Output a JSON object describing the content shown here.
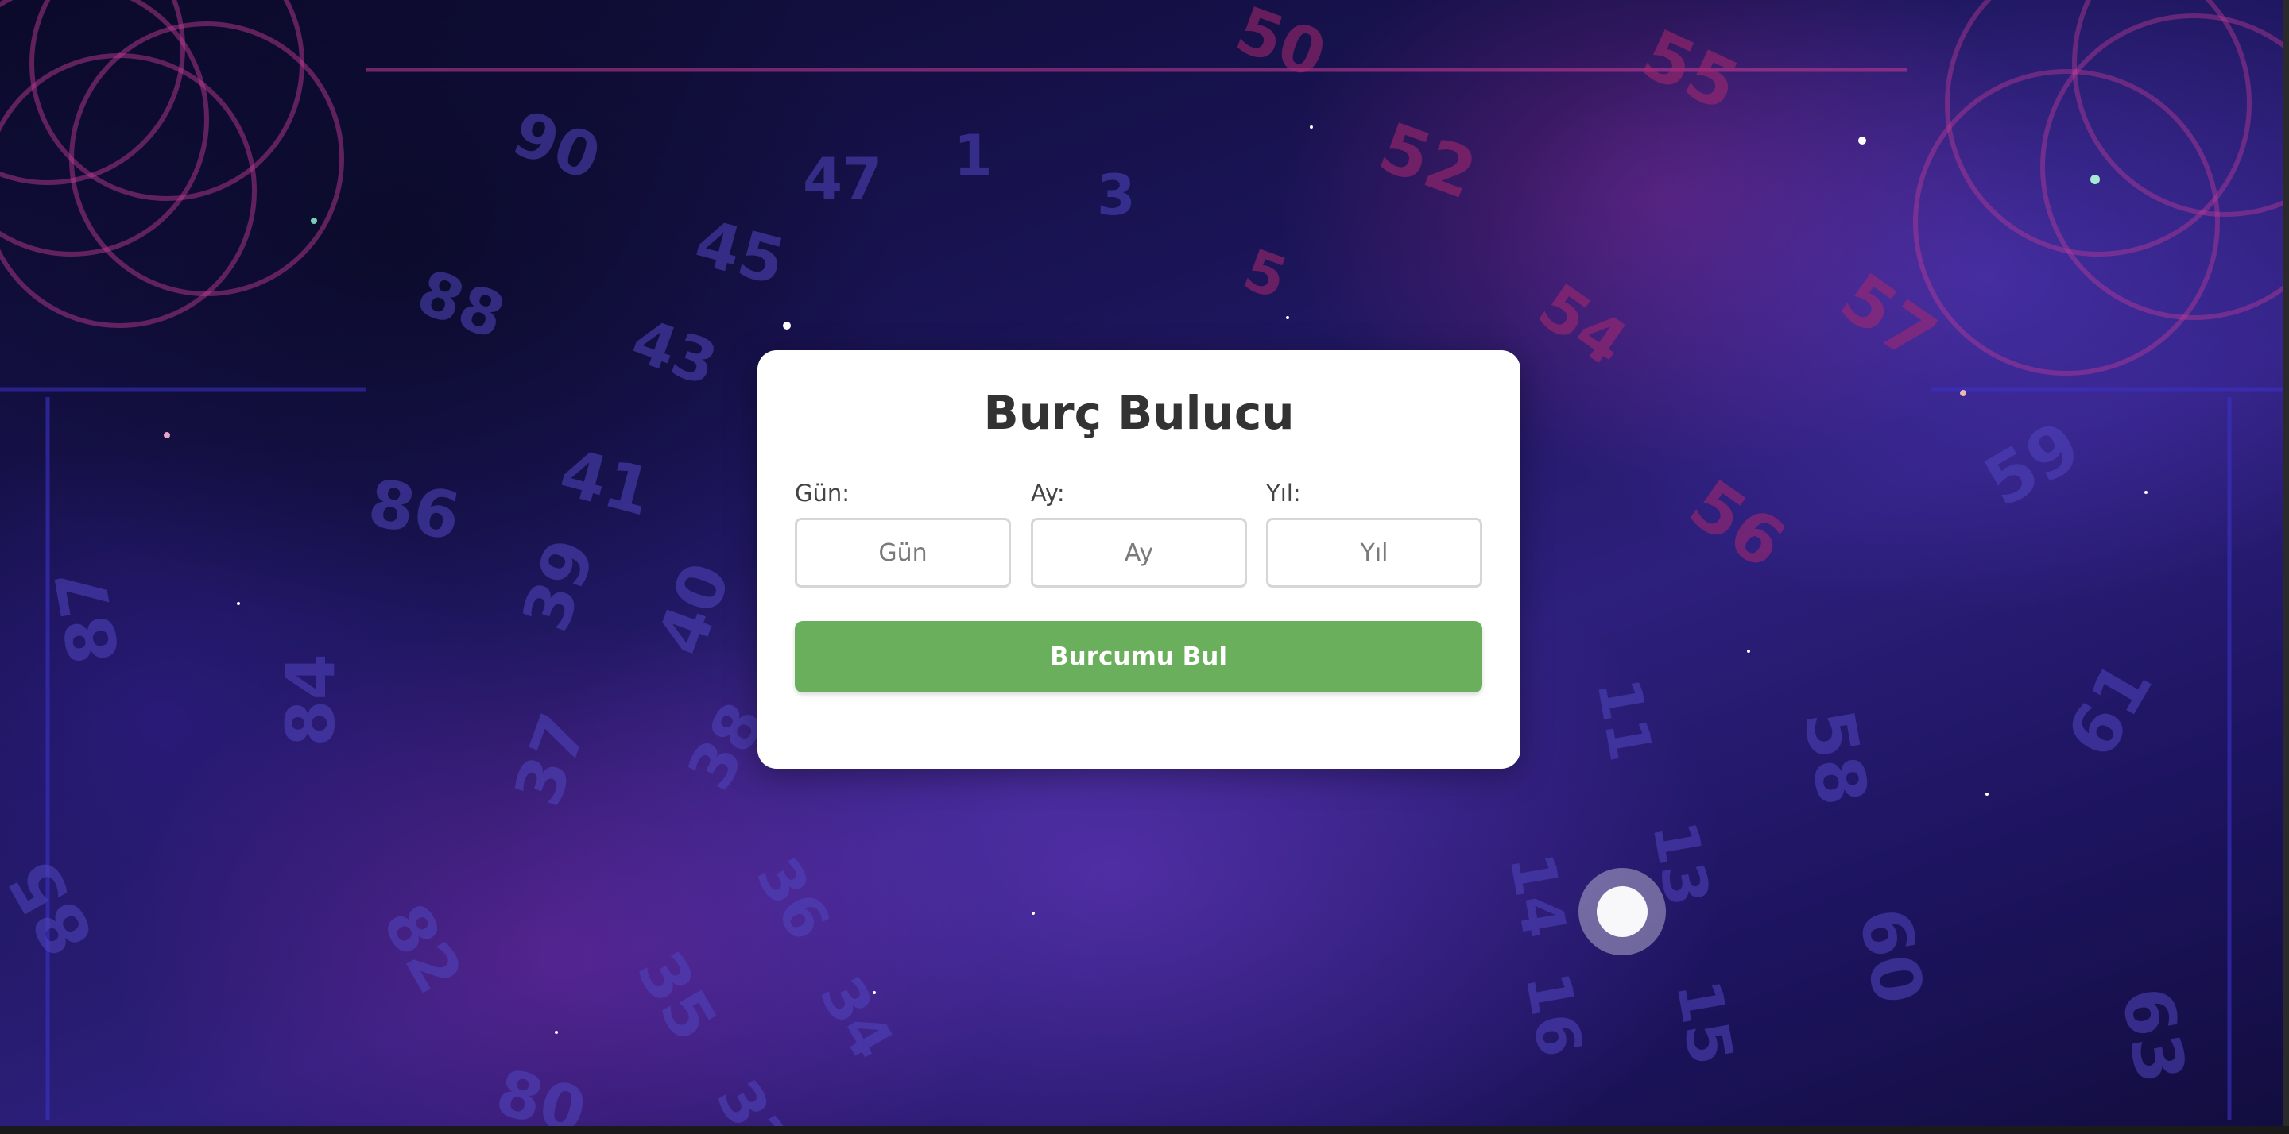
{
  "card": {
    "title": "Burç Bulucu",
    "fields": [
      {
        "label": "Gün:",
        "placeholder": "Gün",
        "value": ""
      },
      {
        "label": "Ay:",
        "placeholder": "Ay",
        "value": ""
      },
      {
        "label": "Yıl:",
        "placeholder": "Yıl",
        "value": ""
      }
    ],
    "submit_label": "Burcumu Bul"
  },
  "background": {
    "theme": "starry-nebula",
    "colors": {
      "deep": "#0b0a2a",
      "mid": "#2d1f7c",
      "accent_pink": "#aa286e",
      "accent_violet": "#6e3cc8"
    }
  },
  "colors": {
    "card_bg": "#ffffff",
    "title": "#333333",
    "button_bg": "#6ab05c",
    "button_text": "#ffffff",
    "input_border": "#d6d6d6"
  }
}
